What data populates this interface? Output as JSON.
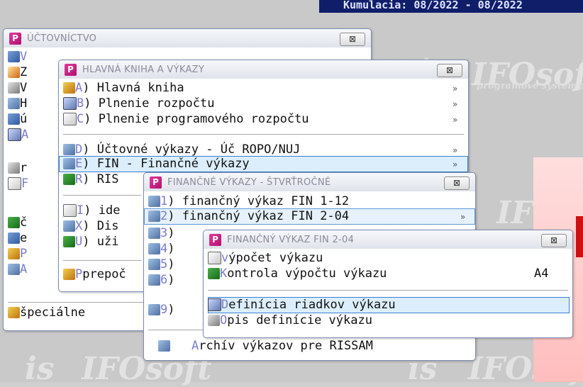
{
  "top_bar": {
    "text": "Kumulacia: 08/2022 - 08/2022"
  },
  "watermark": {
    "brand": "IFOsoft",
    "tagline": "programové systémy",
    "logo": "is"
  },
  "win_uct": {
    "title": "ÚČTOVNÍCTVO",
    "close": "⊠",
    "items": [
      {
        "key": "V",
        "label": "V"
      },
      {
        "key": "Z",
        "label": "Z"
      },
      {
        "key": "V",
        "label": "V"
      },
      {
        "key": "H",
        "label": "H"
      },
      {
        "key": "ú",
        "label": "ú"
      },
      {
        "key": "A",
        "label": "A"
      },
      {
        "key": "r",
        "label": "r"
      },
      {
        "key": "F",
        "label": "F"
      },
      {
        "key": "č",
        "label": "č"
      },
      {
        "key": "e",
        "label": "e"
      },
      {
        "key": "P",
        "label": "P"
      },
      {
        "key": "A",
        "label": "A"
      }
    ],
    "special": "špeciálne"
  },
  "win_hk": {
    "title": "HLAVNÁ KNIHA A VÝKAZY",
    "close": "⊠",
    "items": [
      {
        "key": "A",
        "label": "Hlavná kniha",
        "arrow": "»"
      },
      {
        "key": "B",
        "label": "Plnenie rozpočtu",
        "arrow": "»"
      },
      {
        "key": "C",
        "label": "Plnenie programového rozpočtu",
        "arrow": "»"
      },
      {
        "key": "D",
        "label": "Účtovné výkazy  - Úč ROPO/NUJ",
        "arrow": "»"
      },
      {
        "key": "E",
        "label": "FIN - Finančné výkazy",
        "arrow": "»"
      },
      {
        "key": "R",
        "label": "RIS"
      },
      {
        "key": "I",
        "label": "ide"
      },
      {
        "key": "X",
        "label": "Dis"
      },
      {
        "key": "U",
        "label": "uži"
      }
    ],
    "recalc": "prepoč"
  },
  "win_fin": {
    "title": "FINANČNÉ VÝKAZY - ŠTVRŤROČNÉ",
    "close": "⊠",
    "items": [
      {
        "key": "1",
        "label": "finančný výkaz FIN 1-12"
      },
      {
        "key": "2",
        "label": "finančný výkaz FIN 2-04",
        "arrow": "»"
      },
      {
        "key": "3",
        "label": ")"
      },
      {
        "key": "4",
        "label": ")"
      },
      {
        "key": "5",
        "label": ")"
      },
      {
        "key": "6",
        "label": ")"
      },
      {
        "key": "9",
        "label": ")"
      }
    ],
    "archive_key": "A",
    "archive_rest": "rchív výkazov pre RISSAM"
  },
  "win_fin204": {
    "title": "FINANČNÝ VÝKAZ FIN 2-04",
    "close": "⊠",
    "items": [
      {
        "key": "v",
        "label": "ýpočet výkazu"
      },
      {
        "key": "K",
        "label": "ontrola výpočtu výkazu",
        "code": "A4"
      },
      {
        "key": "D",
        "label": "efinícia riadkov výkazu"
      },
      {
        "key": "O",
        "label": "pis definície výkazu"
      }
    ]
  }
}
